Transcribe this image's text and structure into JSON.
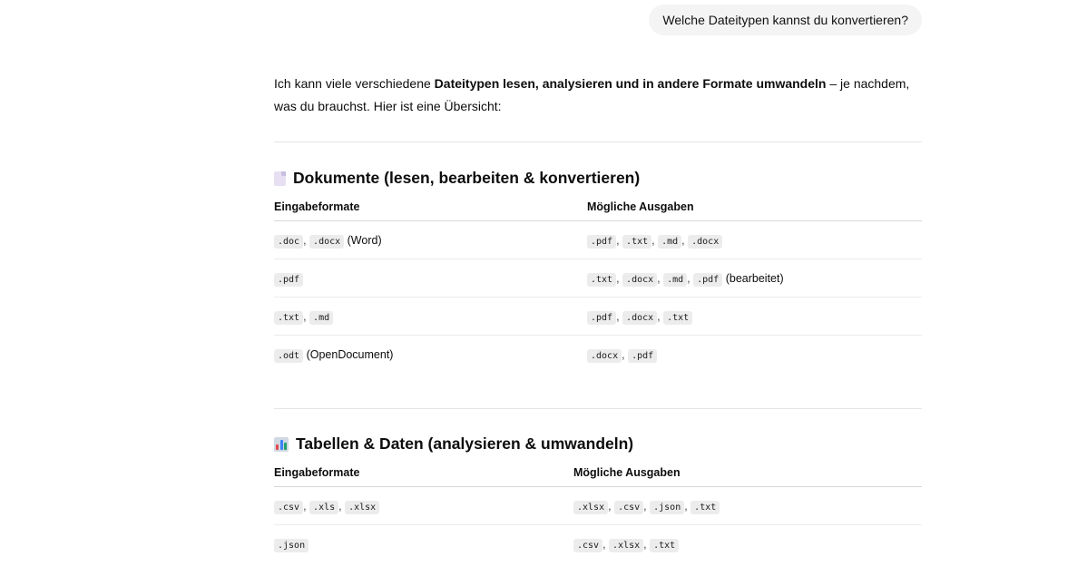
{
  "user_message": "Welche Dateitypen kannst du konvertieren?",
  "intro": {
    "part1": "Ich kann viele verschiedene ",
    "bold": "Dateitypen lesen, analysieren und in andere Formate umwandeln",
    "part2": " – je nachdem, was du brauchst. Hier ist eine Übersicht:"
  },
  "sections": [
    {
      "title": "Dokumente (lesen, bearbeiten & konvertieren)",
      "icon": "page-icon",
      "col_input": "Eingabeformate",
      "col_output": "Mögliche Ausgaben",
      "rows": [
        {
          "input": [
            ".doc",
            ".docx"
          ],
          "input_note": "(Word)",
          "output": [
            ".pdf",
            ".txt",
            ".md",
            ".docx"
          ],
          "output_note": ""
        },
        {
          "input": [
            ".pdf"
          ],
          "input_note": "",
          "output": [
            ".txt",
            ".docx",
            ".md",
            ".pdf"
          ],
          "output_note": "(bearbeitet)"
        },
        {
          "input": [
            ".txt",
            ".md"
          ],
          "input_note": "",
          "output": [
            ".pdf",
            ".docx",
            ".txt"
          ],
          "output_note": ""
        },
        {
          "input": [
            ".odt"
          ],
          "input_note": "(OpenDocument)",
          "output": [
            ".docx",
            ".pdf"
          ],
          "output_note": ""
        }
      ]
    },
    {
      "title": "Tabellen & Daten (analysieren & umwandeln)",
      "icon": "bar-chart-icon",
      "col_input": "Eingabeformate",
      "col_output": "Mögliche Ausgaben",
      "rows": [
        {
          "input": [
            ".csv",
            ".xls",
            ".xlsx"
          ],
          "input_note": "",
          "output": [
            ".xlsx",
            ".csv",
            ".json",
            ".txt"
          ],
          "output_note": ""
        },
        {
          "input": [
            ".json"
          ],
          "input_note": "",
          "output": [
            ".csv",
            ".xlsx",
            ".txt"
          ],
          "output_note": ""
        }
      ]
    }
  ]
}
